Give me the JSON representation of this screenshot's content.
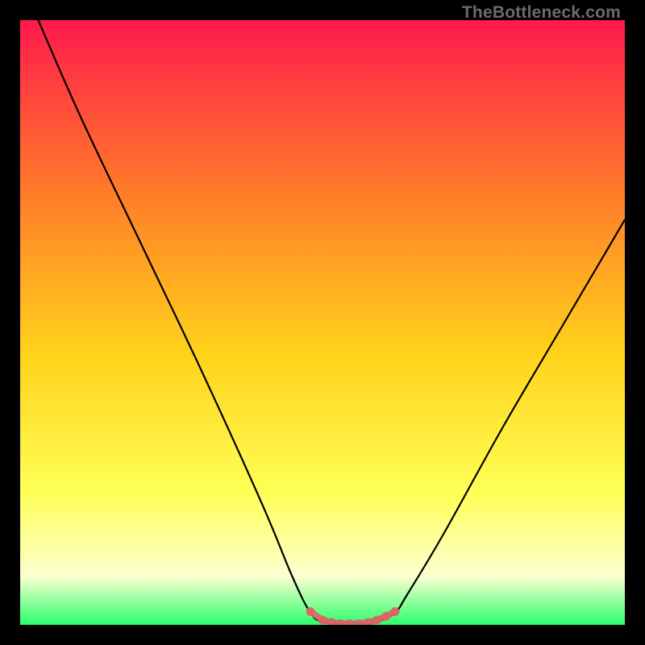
{
  "watermark": "TheBottleneck.com",
  "colors": {
    "background": "#000000",
    "gradient_top": "#ff1a4d",
    "gradient_mid1": "#ff7a2a",
    "gradient_mid2": "#ffd21a",
    "gradient_mid3": "#ffff55",
    "gradient_mid4": "#fcffd0",
    "gradient_bottom": "#2bff6d",
    "curve": "#000000",
    "highlight": "#d96666"
  },
  "chart_data": {
    "type": "line",
    "title": "",
    "xlabel": "",
    "ylabel": "",
    "xlim": [
      0,
      100
    ],
    "ylim": [
      0,
      100
    ],
    "series": [
      {
        "name": "bottleneck-curve",
        "x": [
          3,
          10,
          20,
          30,
          40,
          45,
          48,
          50,
          53,
          56,
          59,
          62,
          64,
          70,
          80,
          90,
          100
        ],
        "y": [
          100,
          84,
          63,
          42,
          20,
          8,
          2,
          0.5,
          0.2,
          0.2,
          0.5,
          2,
          5,
          15,
          33,
          50,
          67
        ]
      }
    ],
    "highlight_segment": {
      "name": "optimal-range",
      "x": [
        48,
        50,
        51.5,
        53,
        54.5,
        56,
        57.5,
        59,
        60.5,
        62
      ],
      "y": [
        2.2,
        0.8,
        0.4,
        0.2,
        0.2,
        0.2,
        0.4,
        0.8,
        1.4,
        2.2
      ]
    }
  }
}
